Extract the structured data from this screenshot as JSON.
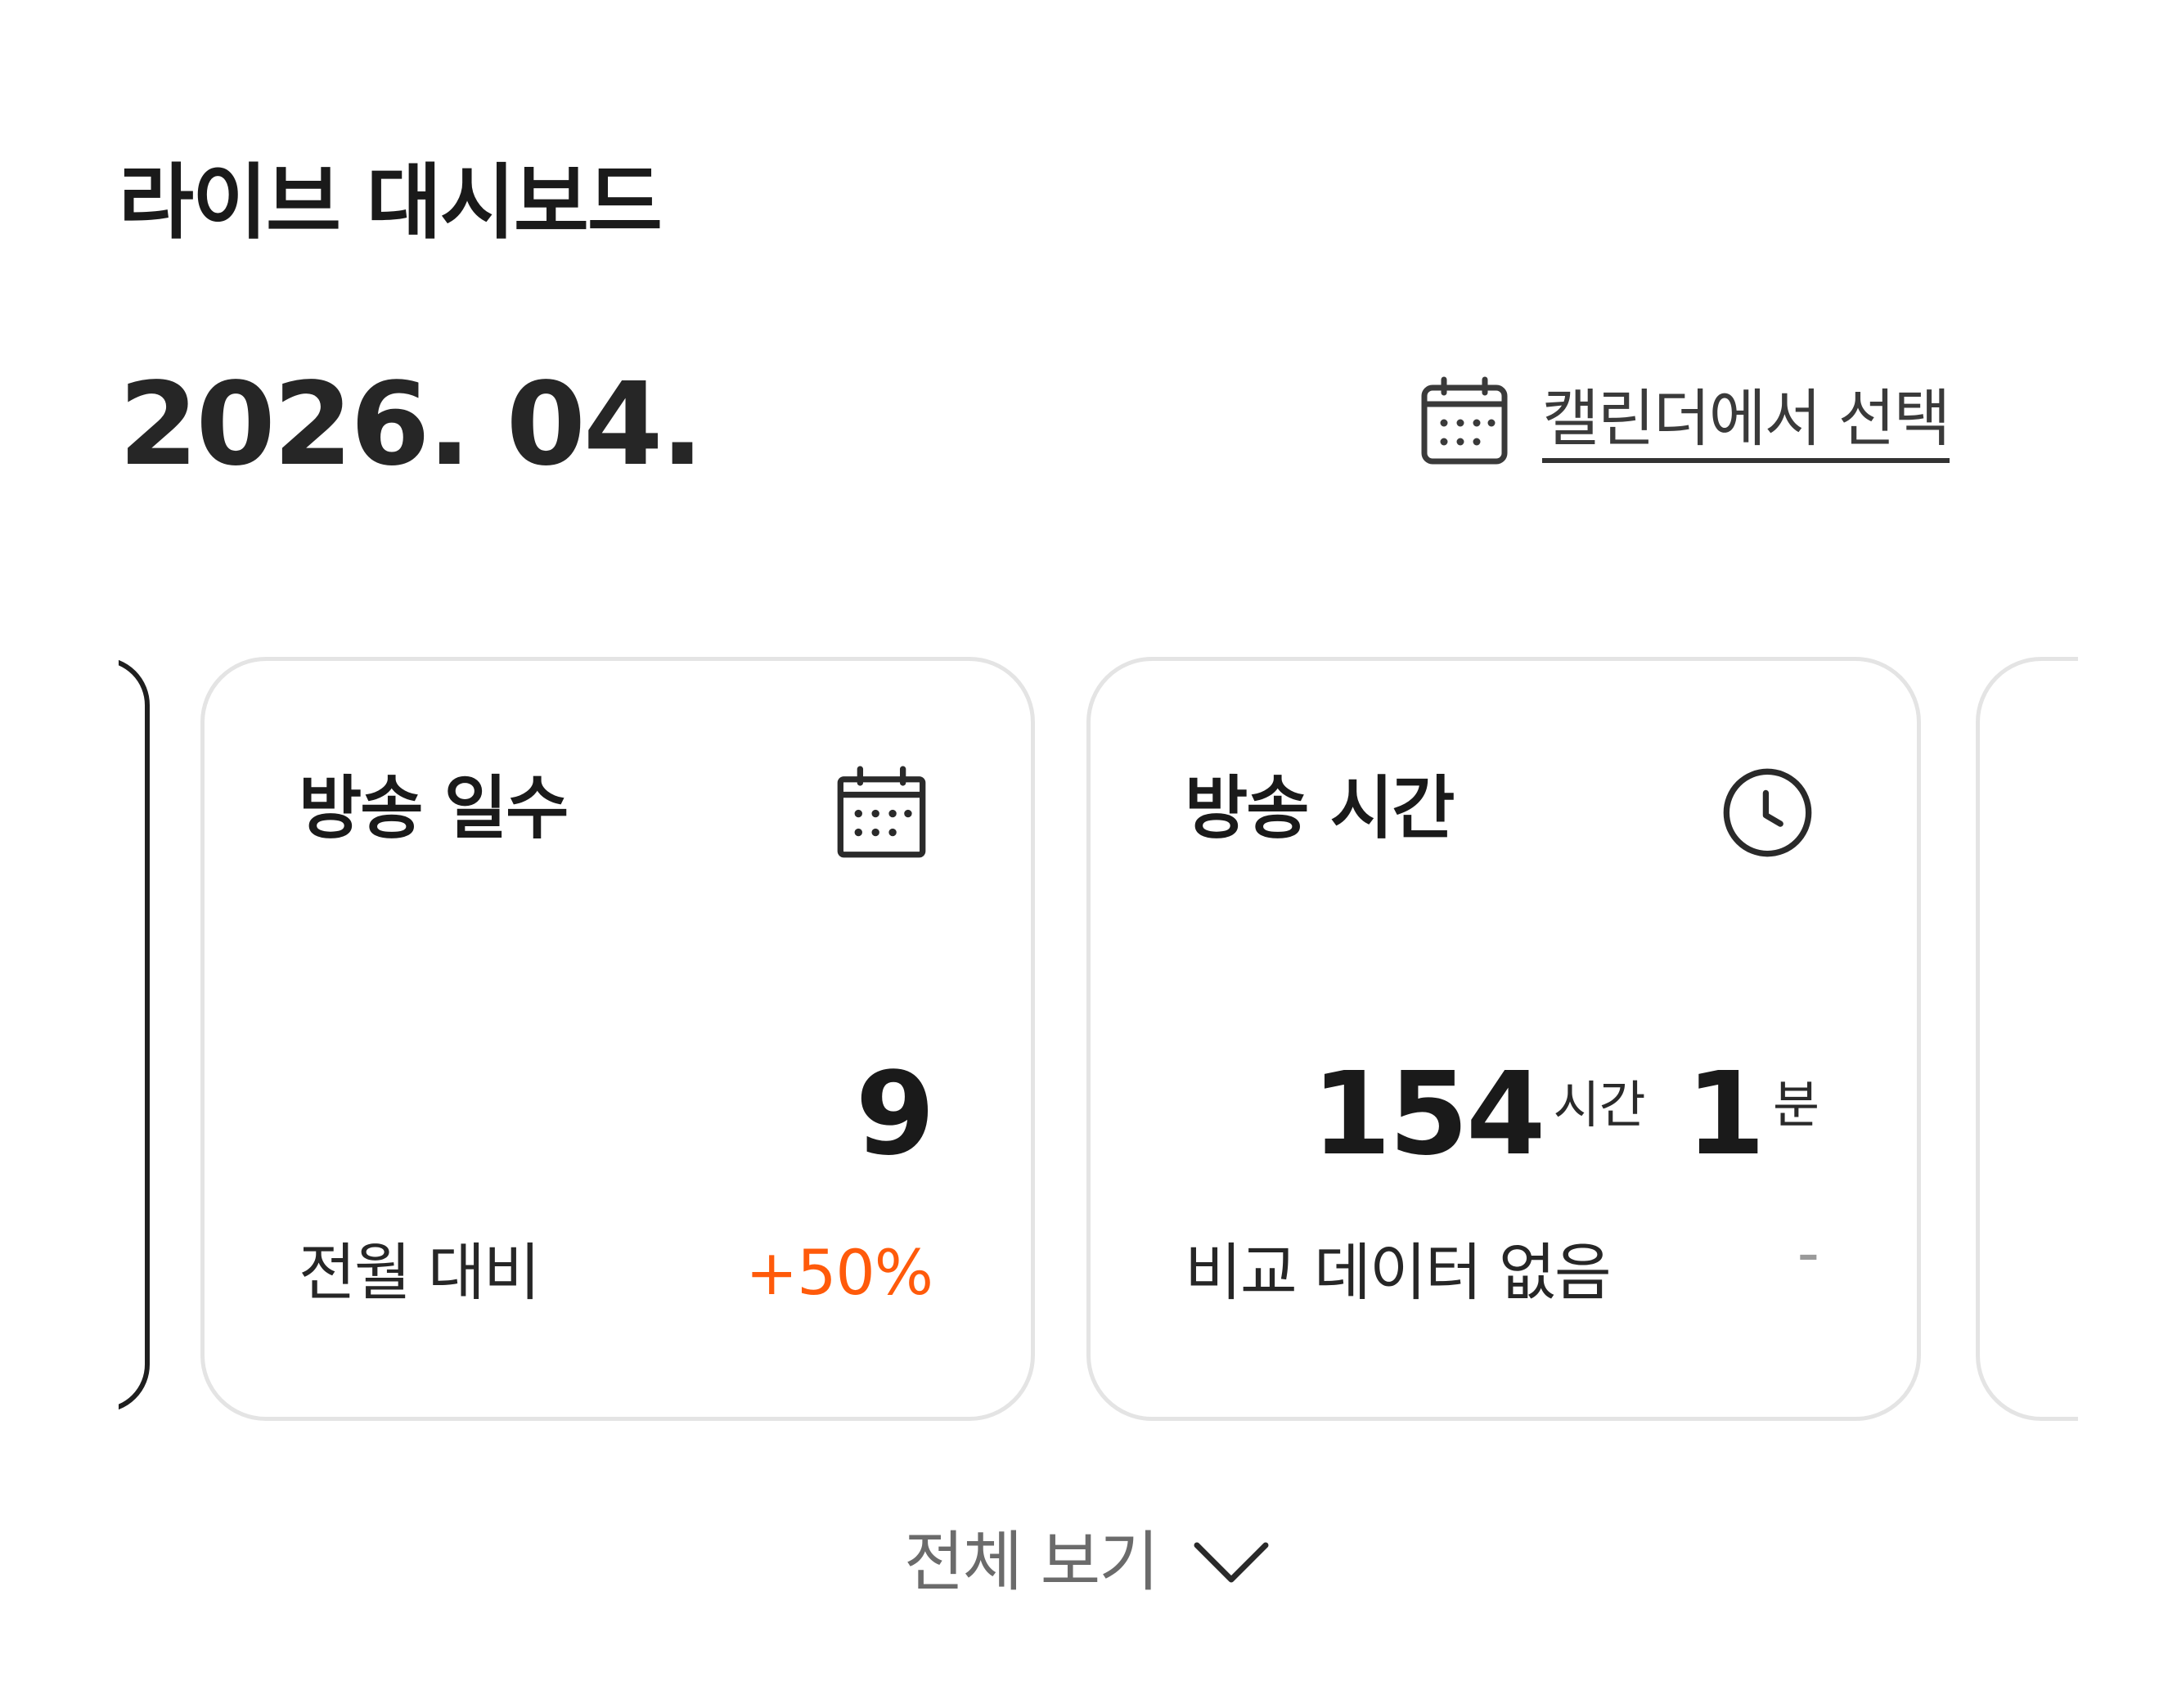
{
  "header": {
    "title": "라이브 대시보드"
  },
  "period": {
    "month_label": "2026. 04.",
    "calendar_link_label": "캘린더에서 선택",
    "calendar_link_icon": "calendar-icon"
  },
  "cards": [
    {
      "title": "방송 일수",
      "icon": "calendar-icon",
      "value": "9",
      "comparison_label": "전월 대비",
      "comparison_value": "+50%",
      "comparison_color": "#ff5a0a"
    },
    {
      "title": "방송 시간",
      "icon": "clock-icon",
      "value_hours": "154",
      "hours_unit": "시간",
      "value_minutes": "1",
      "minutes_unit": "분",
      "comparison_label": "비교 데이터 없음",
      "comparison_value": "-"
    }
  ],
  "footer": {
    "view_all_label": "전체 보기",
    "view_all_icon": "chevron-down-icon"
  }
}
